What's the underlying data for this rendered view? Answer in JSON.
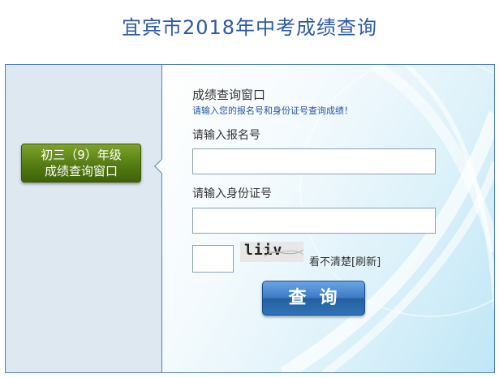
{
  "page": {
    "title": "宜宾市2018年中考成绩查询"
  },
  "sidebar": {
    "badge_line1": "初三（9）年级",
    "badge_line2": "成绩查询窗口"
  },
  "form": {
    "panel_title": "成绩查询窗口",
    "hint": "请输入您的报名号和身份证号查询成绩！",
    "registration_label": "请输入报名号",
    "registration_value": "",
    "id_label": "请输入身份证号",
    "id_value": "",
    "captcha_value": "",
    "captcha_text": "liiv",
    "refresh_link": "看不清楚[刷新]",
    "search_button": "查询"
  },
  "colors": {
    "title": "#2a5aa8",
    "hint": "#2556a5",
    "frame_border": "#4f7fbf",
    "badge": "#557c13",
    "button": "#2f72b8"
  }
}
